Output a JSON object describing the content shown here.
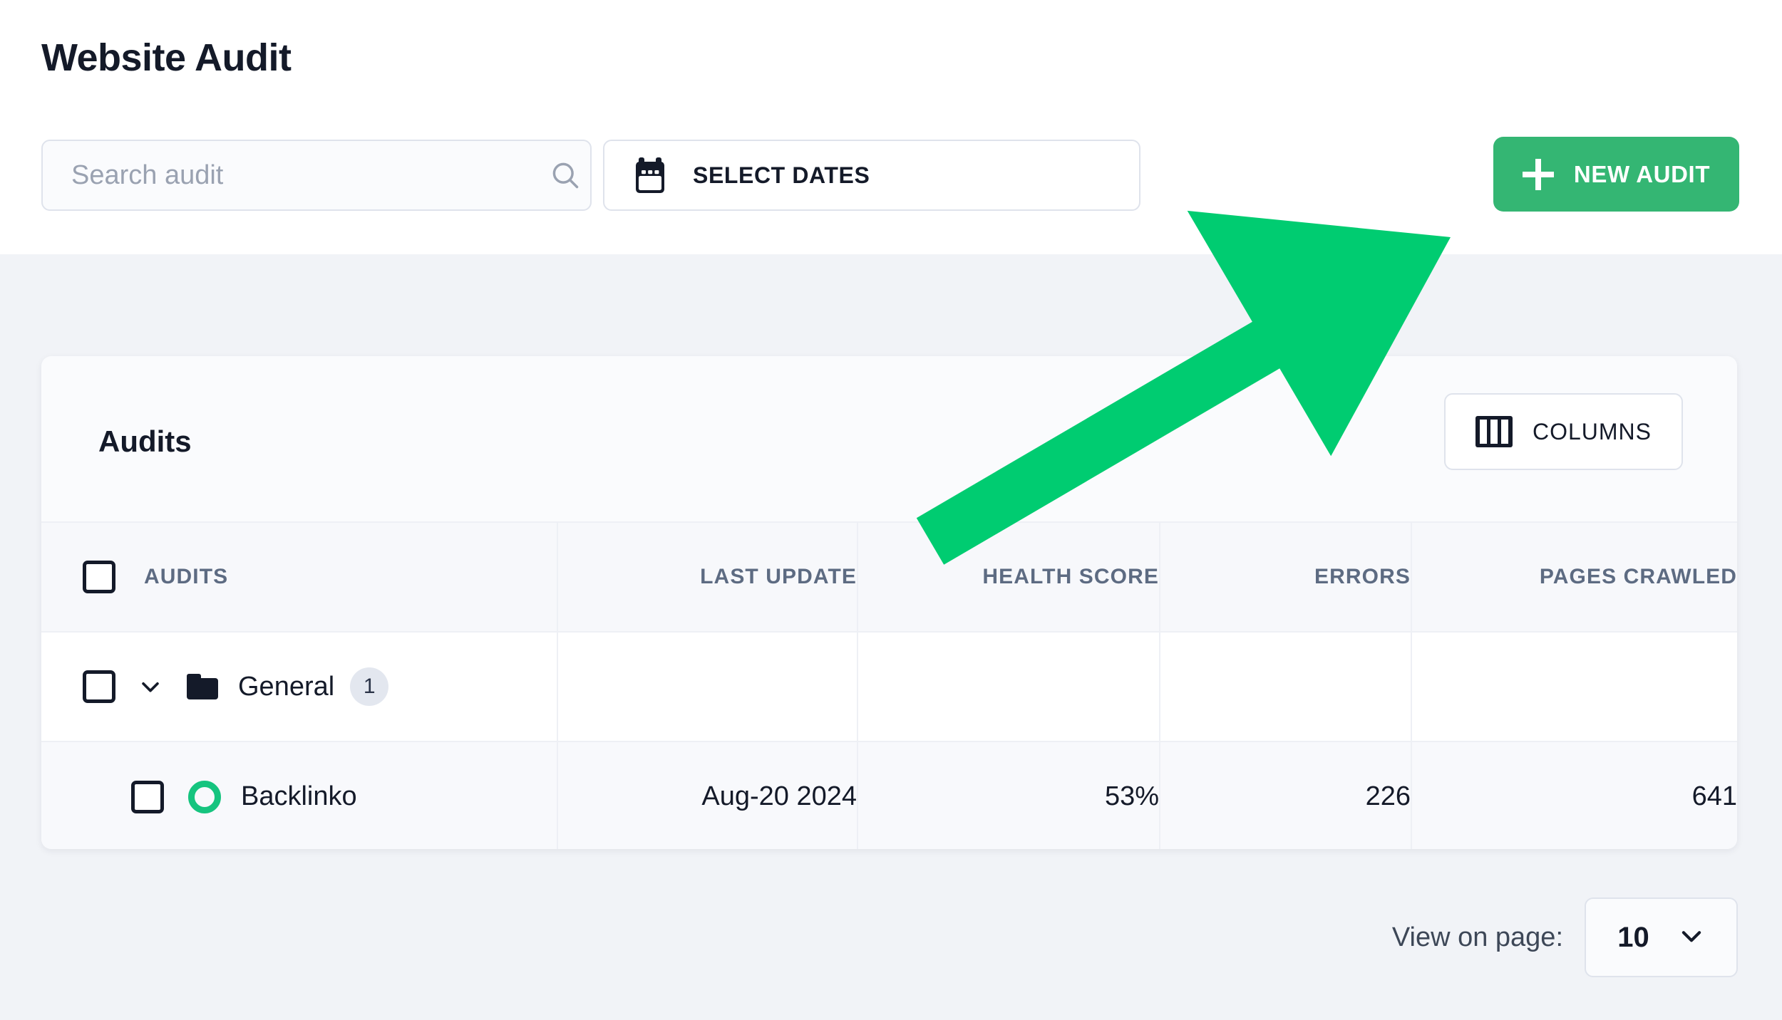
{
  "page": {
    "title": "Website Audit",
    "background_color": "#f1f3f7",
    "accent_color": "#34b673",
    "annotation_color": "#00cc71"
  },
  "search": {
    "placeholder": "Search audit",
    "value": "",
    "icon": "search-icon"
  },
  "dates_button": {
    "label": "SELECT DATES",
    "icon": "calendar-icon"
  },
  "new_audit_button": {
    "label": "NEW AUDIT",
    "icon": "plus-icon"
  },
  "card": {
    "title": "Audits",
    "columns_button": {
      "label": "COLUMNS",
      "icon": "columns-icon"
    }
  },
  "table": {
    "headers": [
      "AUDITS",
      "LAST UPDATE",
      "HEALTH SCORE",
      "ERRORS",
      "PAGES CRAWLED"
    ],
    "select_all_checkbox": "unchecked",
    "group": {
      "name": "General",
      "count": "1",
      "expanded": true,
      "chevron": "chevron-down-icon",
      "folder_icon": "folder-icon",
      "last_update": "",
      "health_score": "",
      "errors": "",
      "pages_crawled": ""
    },
    "rows": [
      {
        "name": "Backlinko",
        "status_icon": "green-ring-icon",
        "last_update": "Aug-20 2024",
        "health_score": "53%",
        "errors": "226",
        "pages_crawled": "641"
      }
    ]
  },
  "pagination": {
    "label": "View on page:",
    "value": "10",
    "chevron": "chevron-down-icon"
  }
}
